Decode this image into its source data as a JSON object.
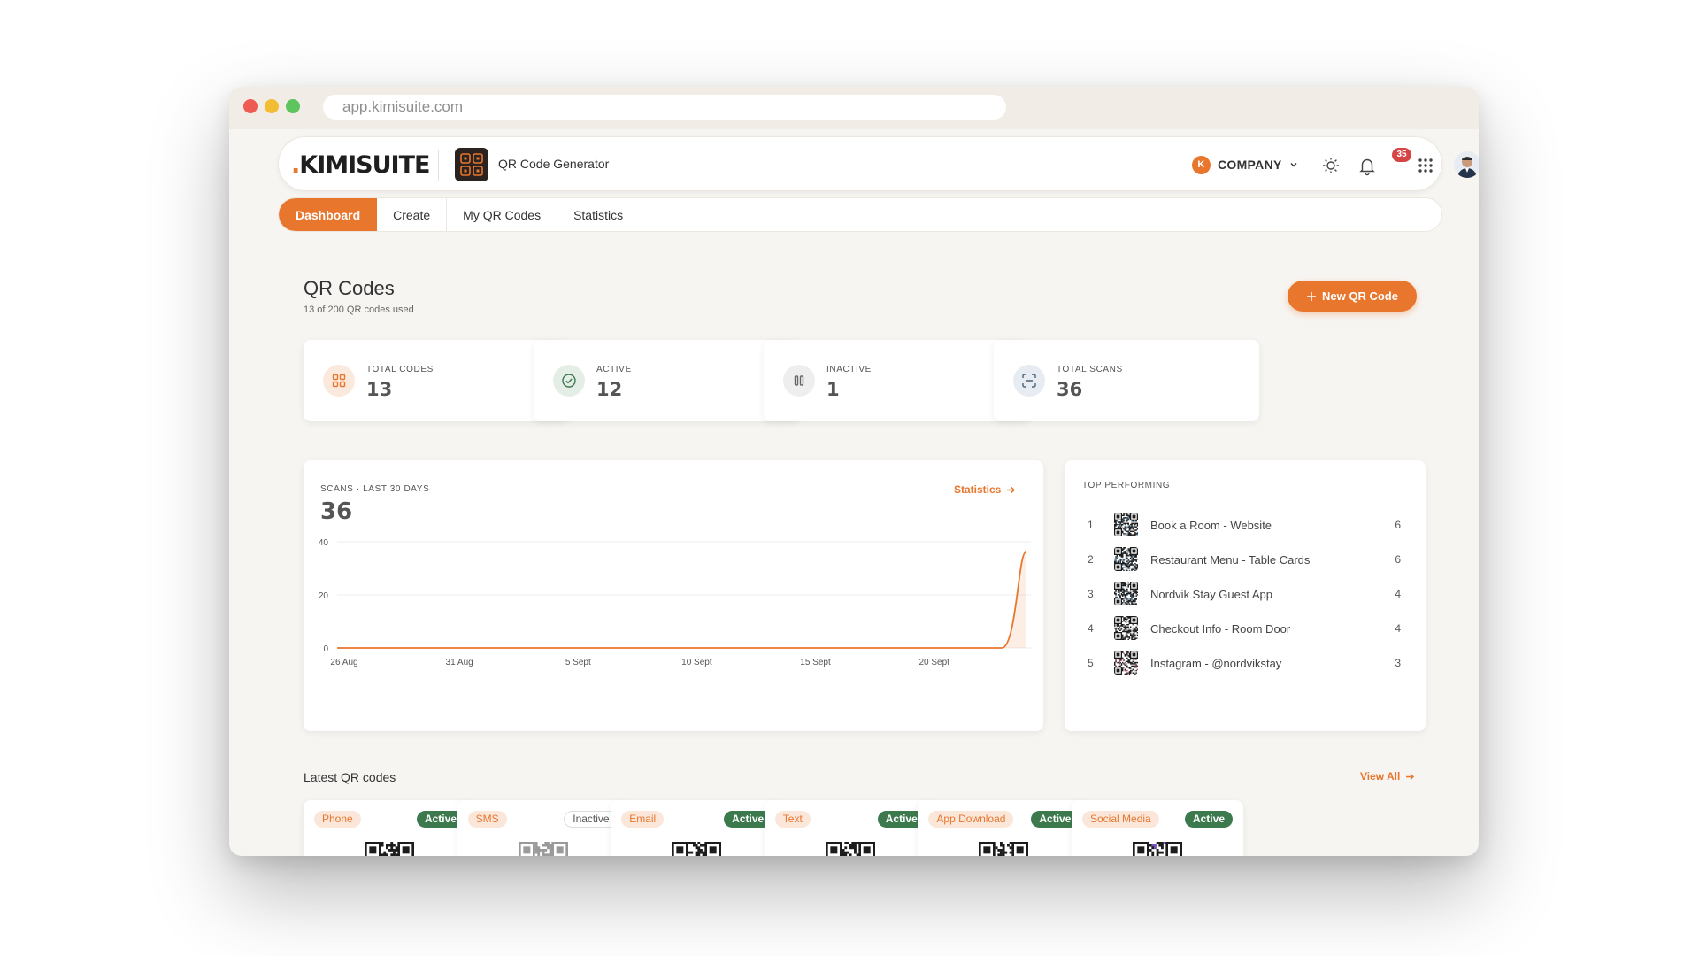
{
  "browser": {
    "url": "app.kimisuite.com"
  },
  "header": {
    "logo_dot": ".",
    "logo_text": "KIMISUITE",
    "app_name": "QR Code Generator",
    "company_initial": "K",
    "company_label": "COMPANY",
    "notification_count": "35",
    "icons": [
      "sun-icon",
      "bell-icon",
      "apps-grid-icon",
      "avatar"
    ]
  },
  "nav": {
    "tabs": [
      {
        "label": "Dashboard",
        "active": true
      },
      {
        "label": "Create"
      },
      {
        "label": "My QR Codes"
      },
      {
        "label": "Statistics"
      }
    ]
  },
  "page": {
    "title": "QR Codes",
    "subtitle": "13 of 200 QR codes used",
    "new_button": "New QR Code"
  },
  "stats": [
    {
      "label": "TOTAL CODES",
      "value": "13",
      "icon": "qr-grid-icon"
    },
    {
      "label": "ACTIVE",
      "value": "12",
      "icon": "check-circle-icon"
    },
    {
      "label": "INACTIVE",
      "value": "1",
      "icon": "pause-icon"
    },
    {
      "label": "TOTAL SCANS",
      "value": "36",
      "icon": "scan-icon"
    }
  ],
  "scans": {
    "label": "SCANS · LAST 30 DAYS",
    "total": "36",
    "link": "Statistics"
  },
  "chart_data": {
    "type": "area",
    "x": [
      "26 Aug",
      "27 Aug",
      "28 Aug",
      "29 Aug",
      "30 Aug",
      "31 Aug",
      "1 Sept",
      "2 Sept",
      "3 Sept",
      "4 Sept",
      "5 Sept",
      "6 Sept",
      "7 Sept",
      "8 Sept",
      "9 Sept",
      "10 Sept",
      "11 Sept",
      "12 Sept",
      "13 Sept",
      "14 Sept",
      "15 Sept",
      "16 Sept",
      "17 Sept",
      "18 Sept",
      "19 Sept",
      "20 Sept",
      "21 Sept",
      "22 Sept",
      "23 Sept",
      "24 Sept"
    ],
    "values": [
      0,
      0,
      0,
      0,
      0,
      0,
      0,
      0,
      0,
      0,
      0,
      0,
      0,
      0,
      0,
      0,
      0,
      0,
      0,
      0,
      0,
      0,
      0,
      0,
      0,
      0,
      0,
      0,
      0,
      36
    ],
    "x_tick_labels": [
      "26 Aug",
      "31 Aug",
      "5 Sept",
      "10 Sept",
      "15 Sept",
      "20 Sept"
    ],
    "y_tick_labels": [
      "0",
      "20",
      "40"
    ],
    "ylim": [
      0,
      40
    ],
    "grid": true,
    "color": "#e8762d"
  },
  "top_performing": {
    "label": "TOP PERFORMING",
    "items": [
      {
        "rank": "1",
        "name": "Book a Room - Website",
        "count": "6"
      },
      {
        "rank": "2",
        "name": "Restaurant Menu - Table Cards",
        "count": "6"
      },
      {
        "rank": "3",
        "name": "Nordvik Stay Guest App",
        "count": "4"
      },
      {
        "rank": "4",
        "name": "Checkout Info - Room Door",
        "count": "4"
      },
      {
        "rank": "5",
        "name": "Instagram - @nordvikstay",
        "count": "3"
      }
    ]
  },
  "latest": {
    "title": "Latest QR codes",
    "view_all": "View All",
    "cards": [
      {
        "type": "Phone",
        "status": "Active"
      },
      {
        "type": "SMS",
        "status": "Inactive"
      },
      {
        "type": "Email",
        "status": "Active"
      },
      {
        "type": "Text",
        "status": "Active"
      },
      {
        "type": "App Download",
        "status": "Active"
      },
      {
        "type": "Social Media",
        "status": "Active"
      }
    ]
  },
  "colors": {
    "accent": "#e8762d",
    "active": "#3c7a4e",
    "badge": "#d64545"
  }
}
